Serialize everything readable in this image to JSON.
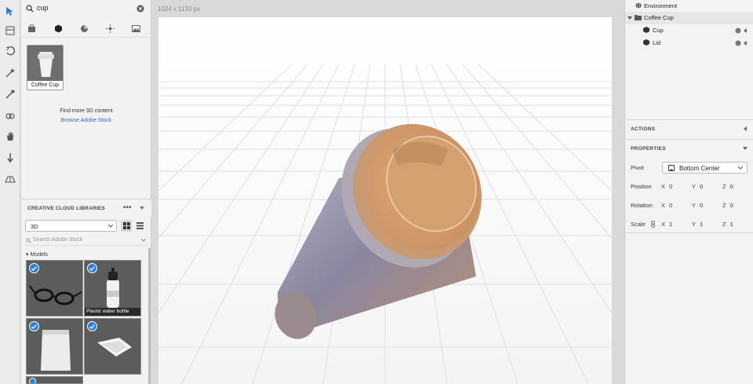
{
  "search": {
    "value": "cup"
  },
  "asset_tile": {
    "label": "Coffee Cup"
  },
  "find_more": {
    "text": "Find more 3D content",
    "link": "Browse Adobe Stock"
  },
  "libraries": {
    "title": "CREATIVE CLOUD LIBRARIES",
    "selected": "3D",
    "search_placeholder": "Search Adobe Stock",
    "section": "Models",
    "items": [
      {
        "label": ""
      },
      {
        "label": "Plastic water bottle"
      },
      {
        "label": ""
      },
      {
        "label": ""
      }
    ]
  },
  "canvas": {
    "dimensions": "1024 x 1133 px"
  },
  "layers": {
    "environment": "Environment",
    "group": "Coffee Cup",
    "cup": "Cup",
    "lid": "Lid"
  },
  "actions": {
    "title": "ACTIONS"
  },
  "properties": {
    "title": "PROPERTIES",
    "pivot_label": "Pivot",
    "pivot_value": "Bottom Center",
    "position_label": "Position",
    "rotation_label": "Rotation",
    "scale_label": "Scale",
    "position": {
      "x": "0",
      "y": "0",
      "z": "0"
    },
    "rotation": {
      "x": "0",
      "y": "0",
      "z": "0"
    },
    "scale": {
      "x": "1",
      "y": "1",
      "z": "1"
    }
  },
  "colors": {
    "accent": "#2f7fd6",
    "cup_body": "#8f8a99",
    "lid": "#d9a06f"
  }
}
